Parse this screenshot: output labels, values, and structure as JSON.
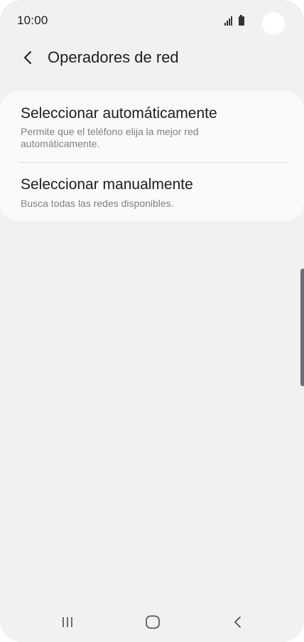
{
  "status_bar": {
    "time": "10:00"
  },
  "header": {
    "title": "Operadores de red"
  },
  "options": [
    {
      "title": "Seleccionar automáticamente",
      "subtitle": "Permite que el teléfono elija la mejor red automáticamente."
    },
    {
      "title": "Seleccionar manualmente",
      "subtitle": "Busca todas las redes disponibles."
    }
  ],
  "icons": {
    "back": "chevron-left-icon",
    "signal": "signal-icon",
    "battery": "battery-icon",
    "recents": "recents-icon",
    "home": "home-icon",
    "nav_back": "nav-back-icon"
  },
  "colors": {
    "background": "#f1f1f1",
    "card": "#fafafa",
    "title_text": "#1c1c1c",
    "subtitle_text": "#808080"
  }
}
